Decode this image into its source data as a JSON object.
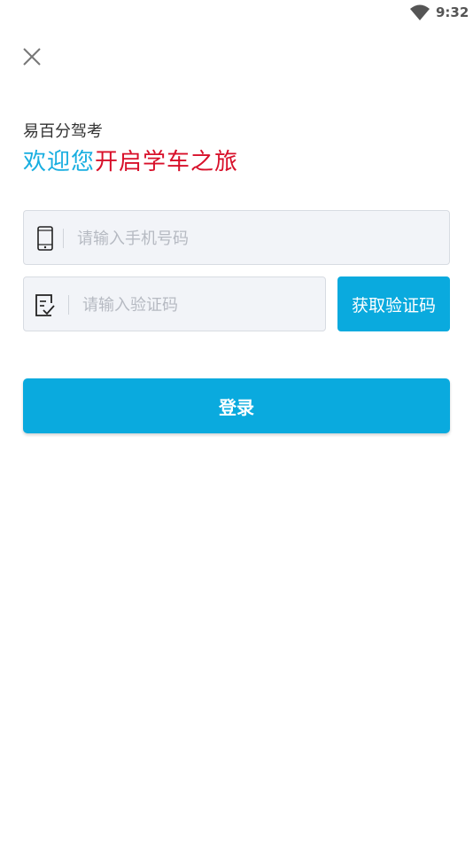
{
  "status_bar": {
    "time": "9:32",
    "wifi_icon": "wifi-icon"
  },
  "header": {
    "close_icon": "close-icon"
  },
  "app_name": "易百分驾考",
  "welcome": {
    "part_a": "欢迎您",
    "part_b": "开启学车之旅"
  },
  "phone": {
    "icon": "mobile-phone-icon",
    "placeholder": "请输入手机号码",
    "value": ""
  },
  "code": {
    "icon": "checklist-icon",
    "placeholder": "请输入验证码",
    "value": ""
  },
  "get_code_label": "获取验证码",
  "login_label": "登录",
  "colors": {
    "accent": "#0aaade",
    "welcome_blue": "#18aee0",
    "welcome_red": "#d8102a",
    "field_bg": "#f2f4f8"
  }
}
